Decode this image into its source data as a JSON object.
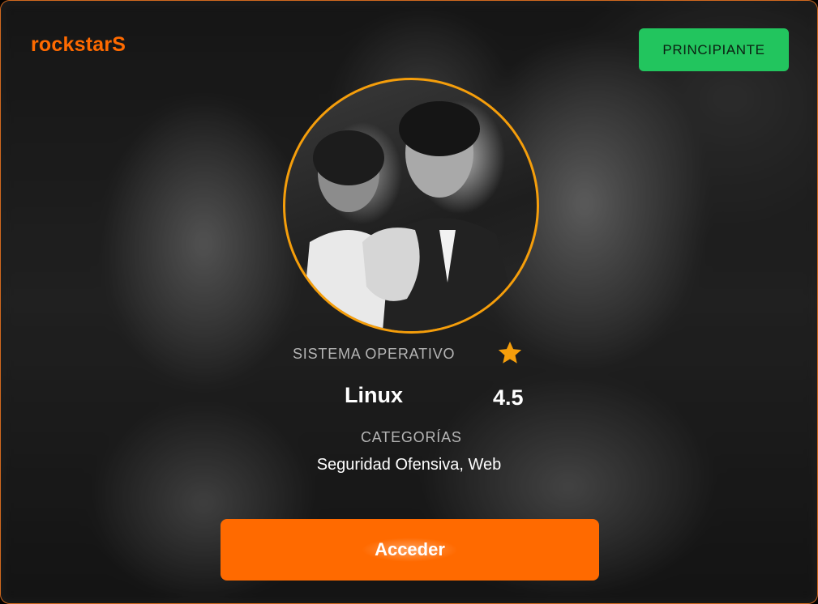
{
  "brand": {
    "name": "rockstarS",
    "color": "#ff6a00"
  },
  "level": {
    "label": "PRINCIPIANTE",
    "color": "#22c55e"
  },
  "avatar": {
    "icon": "profile-photo",
    "border_color": "#f59e0b"
  },
  "os": {
    "label": "SISTEMA OPERATIVO",
    "value": "Linux"
  },
  "rating": {
    "icon": "star-icon",
    "value": "4.5"
  },
  "categories": {
    "label": "CATEGORÍAS",
    "value": "Seguridad Ofensiva, Web"
  },
  "actions": {
    "access_label": "Acceder",
    "accent": "#ff6a00"
  }
}
